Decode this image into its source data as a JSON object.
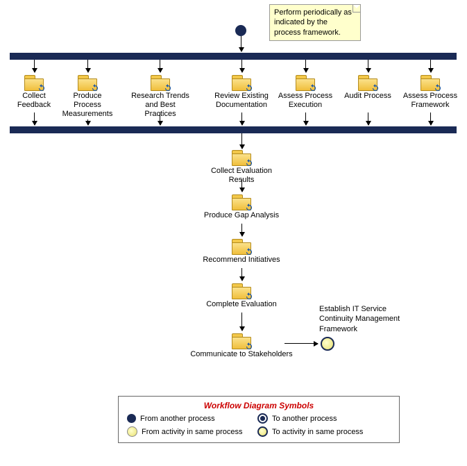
{
  "note": "Perform periodically as indicated by the process framework.",
  "row_activities": [
    {
      "label": "Collect Feedback"
    },
    {
      "label": "Produce Process Measurements"
    },
    {
      "label": "Research Trends and Best Practices"
    },
    {
      "label": "Review Existing Documentation"
    },
    {
      "label": "Assess Process Execution"
    },
    {
      "label": "Audit Process"
    },
    {
      "label": "Assess Process Framework"
    }
  ],
  "seq_activities": [
    {
      "label": "Collect Evaluation Results"
    },
    {
      "label": "Produce Gap Analysis"
    },
    {
      "label": "Recommend Initiatives"
    },
    {
      "label": "Complete Evaluation"
    },
    {
      "label": "Communicate to Stakeholders"
    }
  ],
  "side_label": "Establish IT Service Continuity Management Framework",
  "legend": {
    "title": "Workflow Diagram Symbols",
    "from_another": "From another process",
    "to_another": "To another process",
    "from_same": "From activity in same process",
    "to_same": "To activity in same process"
  }
}
